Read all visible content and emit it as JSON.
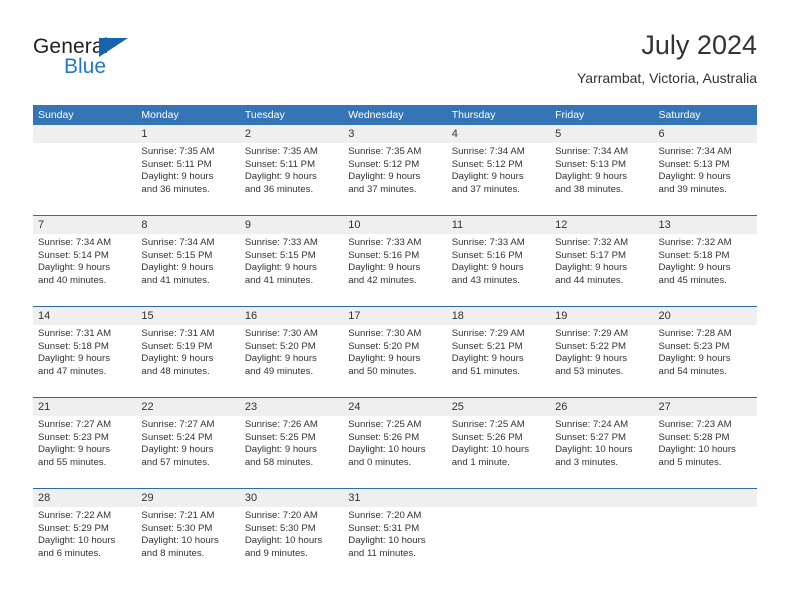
{
  "logo": {
    "word_one": "General",
    "word_two": "Blue",
    "triangle_color": "#1565ad",
    "blue_color": "#2079c7"
  },
  "header": {
    "title": "July 2024",
    "subtitle": "Yarrambat, Victoria, Australia",
    "header_bg": "#3575b6",
    "daynum_bg": "#efefef"
  },
  "weekdays": [
    "Sunday",
    "Monday",
    "Tuesday",
    "Wednesday",
    "Thursday",
    "Friday",
    "Saturday"
  ],
  "weeks": [
    {
      "days": [
        {
          "num": "",
          "lines": []
        },
        {
          "num": "1",
          "lines": [
            "Sunrise: 7:35 AM",
            "Sunset: 5:11 PM",
            "Daylight: 9 hours",
            "and 36 minutes."
          ]
        },
        {
          "num": "2",
          "lines": [
            "Sunrise: 7:35 AM",
            "Sunset: 5:11 PM",
            "Daylight: 9 hours",
            "and 36 minutes."
          ]
        },
        {
          "num": "3",
          "lines": [
            "Sunrise: 7:35 AM",
            "Sunset: 5:12 PM",
            "Daylight: 9 hours",
            "and 37 minutes."
          ]
        },
        {
          "num": "4",
          "lines": [
            "Sunrise: 7:34 AM",
            "Sunset: 5:12 PM",
            "Daylight: 9 hours",
            "and 37 minutes."
          ]
        },
        {
          "num": "5",
          "lines": [
            "Sunrise: 7:34 AM",
            "Sunset: 5:13 PM",
            "Daylight: 9 hours",
            "and 38 minutes."
          ]
        },
        {
          "num": "6",
          "lines": [
            "Sunrise: 7:34 AM",
            "Sunset: 5:13 PM",
            "Daylight: 9 hours",
            "and 39 minutes."
          ]
        }
      ]
    },
    {
      "days": [
        {
          "num": "7",
          "lines": [
            "Sunrise: 7:34 AM",
            "Sunset: 5:14 PM",
            "Daylight: 9 hours",
            "and 40 minutes."
          ]
        },
        {
          "num": "8",
          "lines": [
            "Sunrise: 7:34 AM",
            "Sunset: 5:15 PM",
            "Daylight: 9 hours",
            "and 41 minutes."
          ]
        },
        {
          "num": "9",
          "lines": [
            "Sunrise: 7:33 AM",
            "Sunset: 5:15 PM",
            "Daylight: 9 hours",
            "and 41 minutes."
          ]
        },
        {
          "num": "10",
          "lines": [
            "Sunrise: 7:33 AM",
            "Sunset: 5:16 PM",
            "Daylight: 9 hours",
            "and 42 minutes."
          ]
        },
        {
          "num": "11",
          "lines": [
            "Sunrise: 7:33 AM",
            "Sunset: 5:16 PM",
            "Daylight: 9 hours",
            "and 43 minutes."
          ]
        },
        {
          "num": "12",
          "lines": [
            "Sunrise: 7:32 AM",
            "Sunset: 5:17 PM",
            "Daylight: 9 hours",
            "and 44 minutes."
          ]
        },
        {
          "num": "13",
          "lines": [
            "Sunrise: 7:32 AM",
            "Sunset: 5:18 PM",
            "Daylight: 9 hours",
            "and 45 minutes."
          ]
        }
      ]
    },
    {
      "days": [
        {
          "num": "14",
          "lines": [
            "Sunrise: 7:31 AM",
            "Sunset: 5:18 PM",
            "Daylight: 9 hours",
            "and 47 minutes."
          ]
        },
        {
          "num": "15",
          "lines": [
            "Sunrise: 7:31 AM",
            "Sunset: 5:19 PM",
            "Daylight: 9 hours",
            "and 48 minutes."
          ]
        },
        {
          "num": "16",
          "lines": [
            "Sunrise: 7:30 AM",
            "Sunset: 5:20 PM",
            "Daylight: 9 hours",
            "and 49 minutes."
          ]
        },
        {
          "num": "17",
          "lines": [
            "Sunrise: 7:30 AM",
            "Sunset: 5:20 PM",
            "Daylight: 9 hours",
            "and 50 minutes."
          ]
        },
        {
          "num": "18",
          "lines": [
            "Sunrise: 7:29 AM",
            "Sunset: 5:21 PM",
            "Daylight: 9 hours",
            "and 51 minutes."
          ]
        },
        {
          "num": "19",
          "lines": [
            "Sunrise: 7:29 AM",
            "Sunset: 5:22 PM",
            "Daylight: 9 hours",
            "and 53 minutes."
          ]
        },
        {
          "num": "20",
          "lines": [
            "Sunrise: 7:28 AM",
            "Sunset: 5:23 PM",
            "Daylight: 9 hours",
            "and 54 minutes."
          ]
        }
      ]
    },
    {
      "days": [
        {
          "num": "21",
          "lines": [
            "Sunrise: 7:27 AM",
            "Sunset: 5:23 PM",
            "Daylight: 9 hours",
            "and 55 minutes."
          ]
        },
        {
          "num": "22",
          "lines": [
            "Sunrise: 7:27 AM",
            "Sunset: 5:24 PM",
            "Daylight: 9 hours",
            "and 57 minutes."
          ]
        },
        {
          "num": "23",
          "lines": [
            "Sunrise: 7:26 AM",
            "Sunset: 5:25 PM",
            "Daylight: 9 hours",
            "and 58 minutes."
          ]
        },
        {
          "num": "24",
          "lines": [
            "Sunrise: 7:25 AM",
            "Sunset: 5:26 PM",
            "Daylight: 10 hours",
            "and 0 minutes."
          ]
        },
        {
          "num": "25",
          "lines": [
            "Sunrise: 7:25 AM",
            "Sunset: 5:26 PM",
            "Daylight: 10 hours",
            "and 1 minute."
          ]
        },
        {
          "num": "26",
          "lines": [
            "Sunrise: 7:24 AM",
            "Sunset: 5:27 PM",
            "Daylight: 10 hours",
            "and 3 minutes."
          ]
        },
        {
          "num": "27",
          "lines": [
            "Sunrise: 7:23 AM",
            "Sunset: 5:28 PM",
            "Daylight: 10 hours",
            "and 5 minutes."
          ]
        }
      ]
    },
    {
      "days": [
        {
          "num": "28",
          "lines": [
            "Sunrise: 7:22 AM",
            "Sunset: 5:29 PM",
            "Daylight: 10 hours",
            "and 6 minutes."
          ]
        },
        {
          "num": "29",
          "lines": [
            "Sunrise: 7:21 AM",
            "Sunset: 5:30 PM",
            "Daylight: 10 hours",
            "and 8 minutes."
          ]
        },
        {
          "num": "30",
          "lines": [
            "Sunrise: 7:20 AM",
            "Sunset: 5:30 PM",
            "Daylight: 10 hours",
            "and 9 minutes."
          ]
        },
        {
          "num": "31",
          "lines": [
            "Sunrise: 7:20 AM",
            "Sunset: 5:31 PM",
            "Daylight: 10 hours",
            "and 11 minutes."
          ]
        },
        {
          "num": "",
          "lines": []
        },
        {
          "num": "",
          "lines": []
        },
        {
          "num": "",
          "lines": []
        }
      ]
    }
  ]
}
